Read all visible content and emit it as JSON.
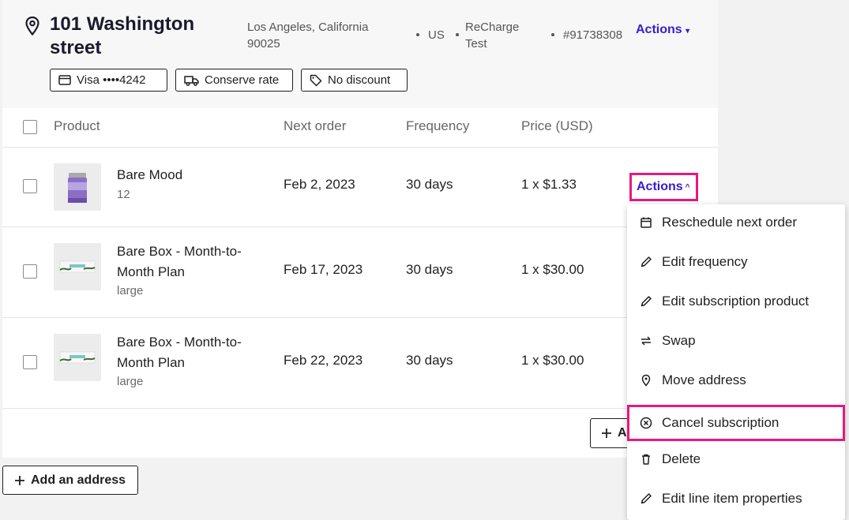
{
  "address": {
    "title": "101 Washington street",
    "city": "Los Angeles, California 90025",
    "country": "US",
    "source": "ReCharge Test",
    "id": "#91738308",
    "actions_label": "Actions",
    "chevron": "▾"
  },
  "pills": {
    "payment": "Visa ••••4242",
    "shipping": "Conserve rate",
    "discount": "No discount"
  },
  "table": {
    "headers": {
      "product": "Product",
      "next_order": "Next order",
      "frequency": "Frequency",
      "price": "Price (USD)"
    },
    "rows": [
      {
        "name": "Bare Mood",
        "variant": "12",
        "next_order": "Feb 2, 2023",
        "frequency": "30 days",
        "price": "1 x $1.33"
      },
      {
        "name": "Bare Box - Month-to-Month Plan",
        "variant": "large",
        "next_order": "Feb 17, 2023",
        "frequency": "30 days",
        "price": "1 x $30.00"
      },
      {
        "name": "Bare Box - Month-to-Month Plan",
        "variant": "large",
        "next_order": "Feb 22, 2023",
        "frequency": "30 days",
        "price": "1 x $30.00"
      }
    ],
    "row_actions_label": "Actions",
    "row_actions_chevron": "^"
  },
  "buttons": {
    "add_partial": "A",
    "add_address": "Add an address"
  },
  "menu": {
    "items": [
      {
        "label": "Reschedule next order",
        "icon": "calendar-icon"
      },
      {
        "label": "Edit frequency",
        "icon": "pencil-icon"
      },
      {
        "label": "Edit subscription product",
        "icon": "pencil-icon"
      },
      {
        "label": "Swap",
        "icon": "swap-arrows-icon"
      },
      {
        "label": "Move address",
        "icon": "location-pin-icon"
      },
      {
        "label": "Cancel subscription",
        "icon": "cancel-circle-icon"
      },
      {
        "label": "Delete",
        "icon": "trash-icon"
      },
      {
        "label": "Edit line item properties",
        "icon": "pencil-icon"
      }
    ]
  },
  "colors": {
    "accent": "#3b1bd1",
    "highlight": "#e6197f"
  }
}
